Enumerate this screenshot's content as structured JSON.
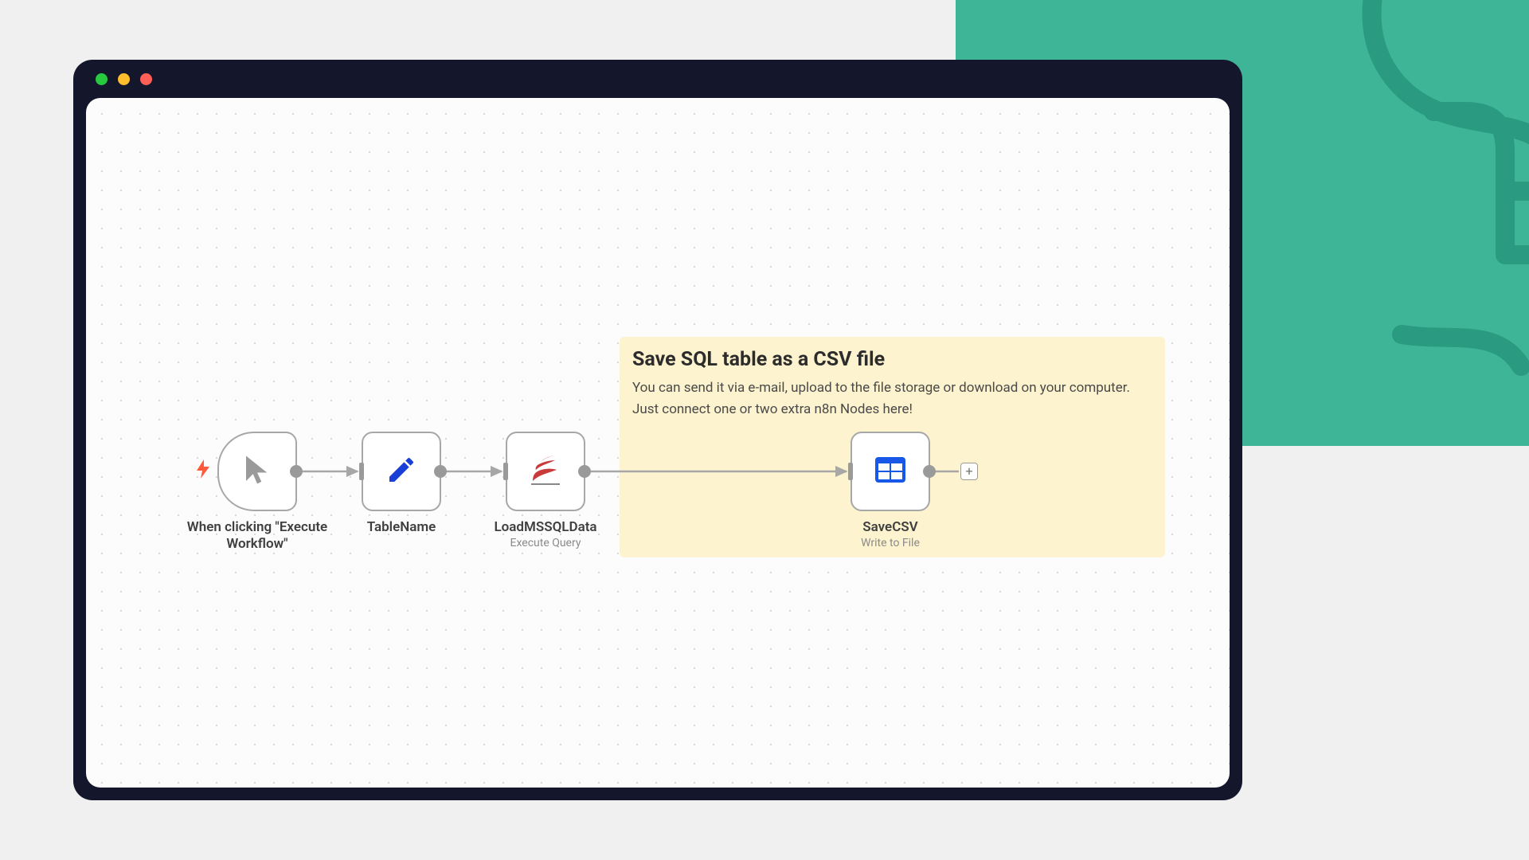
{
  "sticky": {
    "title": "Save SQL table as a CSV file",
    "line1": "You can send it via e-mail, upload to the file storage or download on your computer.",
    "line2": "Just connect one or two extra n8n Nodes here!"
  },
  "nodes": {
    "trigger": {
      "label": "When clicking \"Execute Workflow\""
    },
    "tablename": {
      "label": "TableName"
    },
    "loadmssql": {
      "label": "LoadMSSQLData",
      "sublabel": "Execute Query"
    },
    "savecsv": {
      "label": "SaveCSV",
      "sublabel": "Write to File"
    }
  },
  "add_button": "+"
}
